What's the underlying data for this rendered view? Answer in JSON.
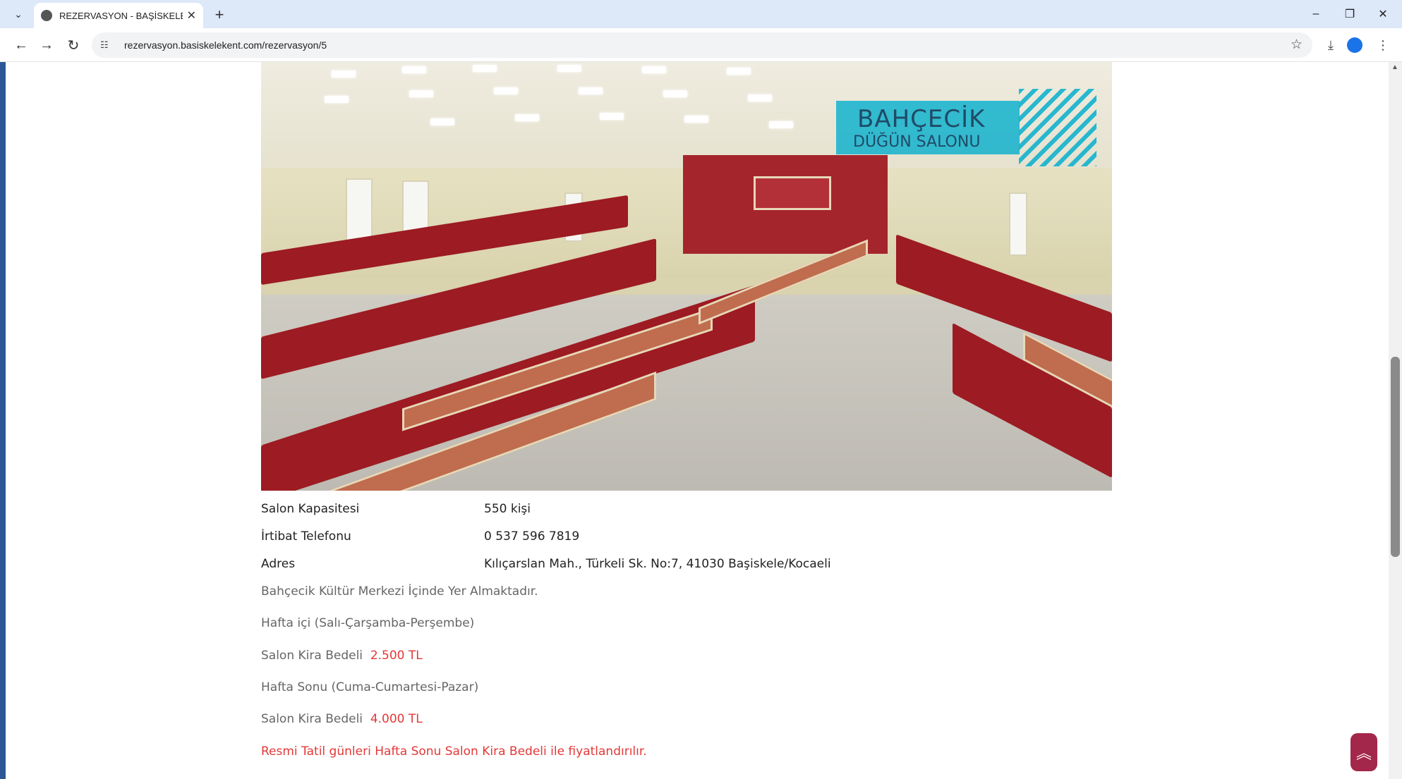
{
  "browser": {
    "tab_title": "REZERVASYON - BAŞİSKELE BE",
    "url": "rezervasyon.basiskelekent.com/rezervasyon/5"
  },
  "photo": {
    "logo_line1": "BAHÇECİK",
    "logo_line2": "DÜĞÜN SALONU"
  },
  "details": [
    {
      "label": "Salon Kapasitesi",
      "value": "550 kişi"
    },
    {
      "label": "İrtibat Telefonu",
      "value": "0 537 596 7819"
    },
    {
      "label": "Adres",
      "value": "Kılıçarslan Mah., Türkeli Sk. No:7, 41030 Başiskele/Kocaeli"
    }
  ],
  "notes": {
    "location": "Bahçecik Kültür Merkezi İçinde Yer Almaktadır.",
    "weekday_title": "Hafta içi (Salı-Çarşamba-Perşembe)",
    "weekday_price_label": "Salon Kira Bedeli",
    "weekday_price": "2.500 TL",
    "weekend_title": "Hafta Sonu (Cuma-Cumartesi-Pazar)",
    "weekend_price_label": "Salon Kira Bedeli",
    "weekend_price": "4.000 TL",
    "holiday_notice": "Resmi Tatil günleri Hafta Sonu Salon Kira Bedeli ile fiyatlandırılır."
  },
  "colors": {
    "price": "#e33838",
    "scroll_top_button": "#a3274b",
    "tabbar": "#dde8f9"
  }
}
